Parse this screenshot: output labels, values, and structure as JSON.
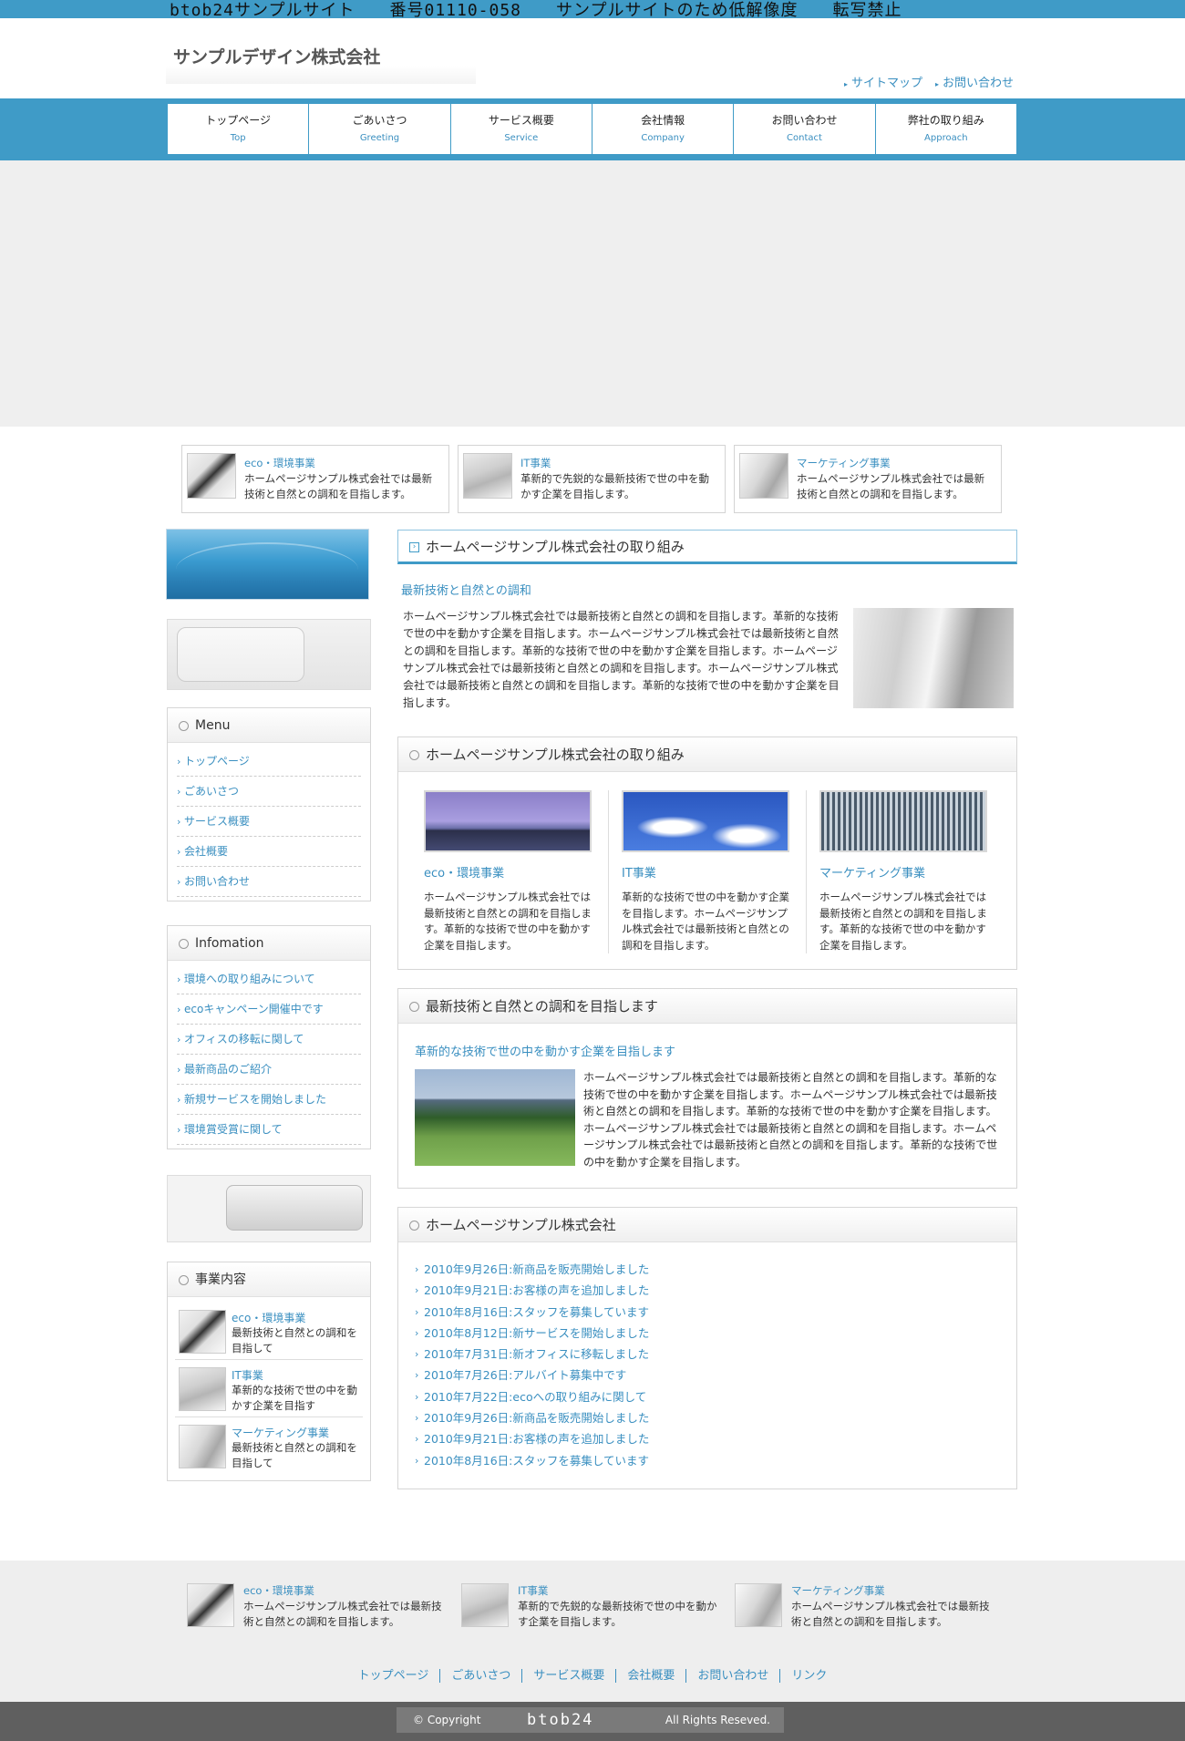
{
  "top_banner": "btob24サンプルサイト　　番号01110-058　　サンプルサイトのため低解像度　　転写禁止",
  "header": {
    "company": "サンプルデザイン株式会社",
    "util_links": [
      "サイトマップ",
      "お問い合わせ"
    ]
  },
  "nav": [
    {
      "jp": "トップページ",
      "en": "Top"
    },
    {
      "jp": "ごあいさつ",
      "en": "Greeting"
    },
    {
      "jp": "サービス概要",
      "en": "Service"
    },
    {
      "jp": "会社情報",
      "en": "Company"
    },
    {
      "jp": "お問い合わせ",
      "en": "Contact"
    },
    {
      "jp": "弊社の取り組み",
      "en": "Approach"
    }
  ],
  "features": [
    {
      "title": "eco・環境事業",
      "desc": "ホームページサンプル株式会社では最新技術と自然との調和を目指します。"
    },
    {
      "title": "IT事業",
      "desc": "革新的で先鋭的な最新技術で世の中を動かす企業を目指します。"
    },
    {
      "title": "マーケティング事業",
      "desc": "ホームページサンプル株式会社では最新技術と自然との調和を目指します。"
    }
  ],
  "sidebar": {
    "menu_title": "Menu",
    "menu": [
      "トップページ",
      "ごあいさつ",
      "サービス概要",
      "会社概要",
      "お問い合わせ"
    ],
    "info_title": "Infomation",
    "info": [
      "環境への取り組みについて",
      "ecoキャンペーン開催中です",
      "オフィスの移転に関して",
      "最新商品のご紹介",
      "新規サービスを開始しました",
      "環境賞受賞に関して"
    ],
    "biz_title": "事業内容",
    "biz": [
      {
        "title": "eco・環境事業",
        "desc": "最新技術と自然との調和を目指して"
      },
      {
        "title": "IT事業",
        "desc": "革新的な技術で世の中を動かす企業を目指す"
      },
      {
        "title": "マーケティング事業",
        "desc": "最新技術と自然との調和を目指して"
      }
    ]
  },
  "main": {
    "s1_title": "ホームページサンプル株式会社の取り組み",
    "s1_sub": "最新技術と自然との調和",
    "s1_text": "ホームページサンプル株式会社では最新技術と自然との調和を目指します。革新的な技術で世の中を動かす企業を目指します。ホームページサンプル株式会社では最新技術と自然との調和を目指します。革新的な技術で世の中を動かす企業を目指します。ホームページサンプル株式会社では最新技術と自然との調和を目指します。ホームページサンプル株式会社では最新技術と自然との調和を目指します。革新的な技術で世の中を動かす企業を目指します。",
    "s2_title": "ホームページサンプル株式会社の取り組み",
    "s2_cols": [
      {
        "title": "eco・環境事業",
        "desc": "ホームページサンプル株式会社では最新技術と自然との調和を目指します。革新的な技術で世の中を動かす企業を目指します。"
      },
      {
        "title": "IT事業",
        "desc": "革新的な技術で世の中を動かす企業を目指します。ホームページサンプル株式会社では最新技術と自然との調和を目指します。"
      },
      {
        "title": "マーケティング事業",
        "desc": "ホームページサンプル株式会社では最新技術と自然との調和を目指します。革新的な技術で世の中を動かす企業を目指します。"
      }
    ],
    "s3_title": "最新技術と自然との調和を目指します",
    "s3_sub": "革新的な技術で世の中を動かす企業を目指します",
    "s3_text": "ホームページサンプル株式会社では最新技術と自然との調和を目指します。革新的な技術で世の中を動かす企業を目指します。ホームページサンプル株式会社では最新技術と自然との調和を目指します。革新的な技術で世の中を動かす企業を目指します。ホームページサンプル株式会社では最新技術と自然との調和を目指します。ホームページサンプル株式会社では最新技術と自然との調和を目指します。革新的な技術で世の中を動かす企業を目指します。",
    "s4_title": "ホームページサンプル株式会社",
    "news": [
      "2010年9月26日:新商品を販売開始しました",
      "2010年9月21日:お客様の声を追加しました",
      "2010年8月16日:スタッフを募集しています",
      "2010年8月12日:新サービスを開始しました",
      "2010年7月31日:新オフィスに移転しました",
      "2010年7月26日:アルバイト募集中です",
      "2010年7月22日:ecoへの取り組みに関して",
      "2010年9月26日:新商品を販売開始しました",
      "2010年9月21日:お客様の声を追加しました",
      "2010年8月16日:スタッフを募集しています"
    ]
  },
  "footer": {
    "links": [
      "トップページ",
      "ごあいさつ",
      "サービス概要",
      "会社概要",
      "お問い合わせ",
      "リンク"
    ],
    "copy_left": "© Copyright",
    "copy_mid": "btob24",
    "copy_right": "All Rights Reseved."
  }
}
